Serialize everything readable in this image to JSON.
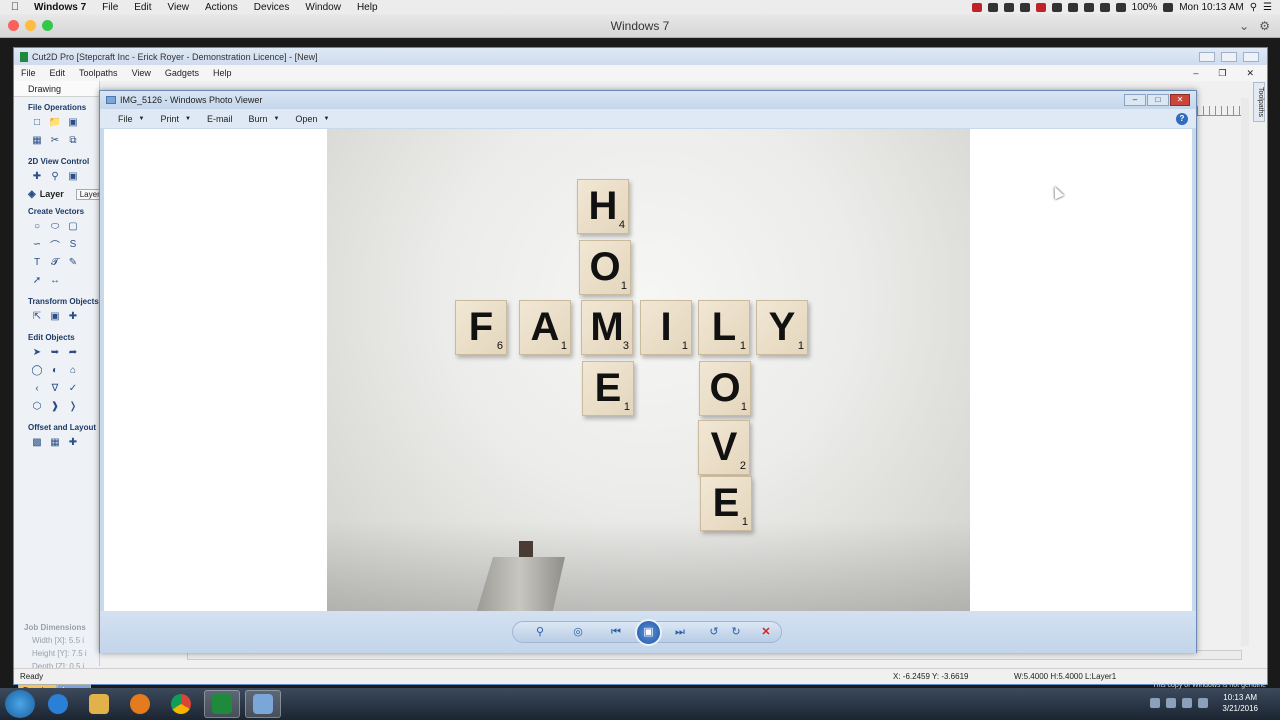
{
  "mac_menu": {
    "app": "Windows 7",
    "items": [
      "File",
      "Edit",
      "View",
      "Actions",
      "Devices",
      "Window",
      "Help"
    ],
    "battery": "100%",
    "clock": "Mon 10:13 AM"
  },
  "vm_window": {
    "title": "Windows 7"
  },
  "cut2d": {
    "title": "Cut2D Pro [Stepcraft Inc - Erick Royer - Demonstration Licence] - [New]",
    "menu": [
      "File",
      "Edit",
      "Toolpaths",
      "View",
      "Gadgets",
      "Help"
    ],
    "panel_tab": "Drawing",
    "sections": {
      "file_ops": "File Operations",
      "view_control": "2D View Control",
      "layer_label": "Layer",
      "layer_button": "Layer",
      "create_vectors": "Create Vectors",
      "transform": "Transform Objects",
      "edit_objects": "Edit Objects",
      "offset": "Offset and Layout"
    },
    "job_dimensions": {
      "heading": "Job Dimensions",
      "width": "Width  [X]: 5.5 i",
      "height": "Height [Y]: 7.5 i",
      "depth": "Depth  [Z]: 0.5 i"
    },
    "bottom_tabs": [
      "Drawing",
      "Layers"
    ],
    "toolpaths_tab": "Toolpaths",
    "status": {
      "ready": "Ready",
      "coords": "X: -6.2459 Y: -3.6619",
      "dims": "W:5.4000  H:5.4000  L:Layer1"
    }
  },
  "photo_viewer": {
    "title": "IMG_5126 - Windows Photo Viewer",
    "menu": [
      "File",
      "Print",
      "E-mail",
      "Burn",
      "Open"
    ],
    "help": "?",
    "tiles": [
      {
        "letter": "H",
        "num": "4"
      },
      {
        "letter": "O",
        "num": "1"
      },
      {
        "letter": "F",
        "num": "6"
      },
      {
        "letter": "A",
        "num": "1"
      },
      {
        "letter": "M",
        "num": "3"
      },
      {
        "letter": "I",
        "num": "1"
      },
      {
        "letter": "L",
        "num": "1"
      },
      {
        "letter": "Y",
        "num": "1"
      },
      {
        "letter": "E",
        "num": "1"
      },
      {
        "letter": "O",
        "num": "1"
      },
      {
        "letter": "V",
        "num": "2"
      },
      {
        "letter": "E",
        "num": "1"
      }
    ]
  },
  "taskbar": {
    "notice": "This copy of Windows is not genuine",
    "time": "10:13 AM",
    "date": "3/21/2016"
  },
  "colors": {
    "win_accent": "#c8463a",
    "viewer_chrome": "#c9d9ec",
    "tile": "#efe4cf"
  }
}
